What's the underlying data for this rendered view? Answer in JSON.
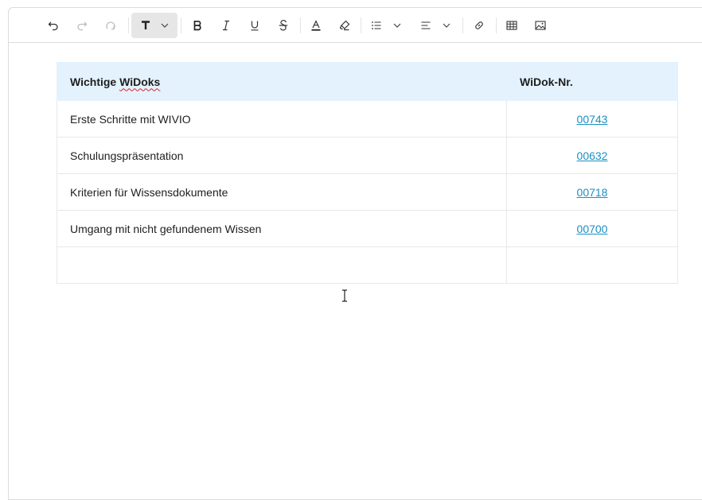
{
  "toolbar": {
    "buttons": [
      {
        "name": "undo-icon"
      },
      {
        "name": "redo-icon"
      },
      {
        "name": "clear-format-icon"
      },
      {
        "name": "text-format-icon"
      },
      {
        "name": "bold-icon"
      },
      {
        "name": "italic-icon"
      },
      {
        "name": "underline-icon"
      },
      {
        "name": "strikethrough-icon"
      },
      {
        "name": "font-color-icon"
      },
      {
        "name": "highlight-icon"
      },
      {
        "name": "list-icon"
      },
      {
        "name": "align-icon"
      },
      {
        "name": "link-icon"
      },
      {
        "name": "table-icon"
      },
      {
        "name": "image-icon"
      }
    ]
  },
  "table": {
    "header": {
      "col1_part1": "Wichtige ",
      "col1_part2": "WiDoks",
      "col2": "WiDok-Nr."
    },
    "rows": [
      {
        "title": "Erste Schritte mit WIVIO",
        "number": "00743"
      },
      {
        "title": "Schulungspräsentation",
        "number": "00632"
      },
      {
        "title": "Kriterien für Wissensdokumente",
        "number": "00718"
      },
      {
        "title": "Umgang mit nicht gefundenem Wissen",
        "number": "00700"
      },
      {
        "title": "",
        "number": ""
      }
    ]
  },
  "colors": {
    "header_bg": "#e3f2fd",
    "link": "#1a8fc4",
    "border": "#e8e8e8"
  }
}
